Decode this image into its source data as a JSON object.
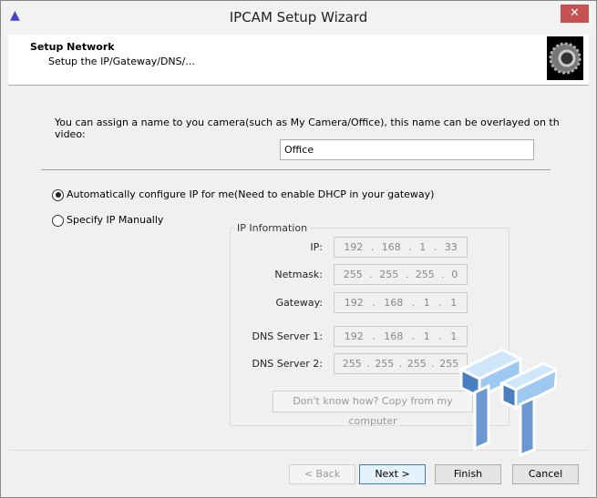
{
  "window": {
    "title": "IPCAM Setup Wizard",
    "close_label": "✕"
  },
  "header": {
    "title": "Setup Network",
    "subtitle": "Setup the IP/Gateway/DNS/..."
  },
  "name_section": {
    "prompt": "You can assign a name to you camera(such as My Camera/Office), this name can be overlayed on th video:",
    "value": "Office"
  },
  "options": {
    "auto": {
      "label": "Automatically configure IP for me(Need to enable DHCP in your gateway)",
      "selected": true
    },
    "manual": {
      "label": "Specify IP Manually",
      "selected": false
    }
  },
  "ip_info": {
    "legend": "IP Information",
    "fields": [
      {
        "label": "IP:",
        "octets": [
          "192",
          "168",
          "1",
          "33"
        ]
      },
      {
        "label": "Netmask:",
        "octets": [
          "255",
          "255",
          "255",
          "0"
        ]
      },
      {
        "label": "Gateway:",
        "octets": [
          "192",
          "168",
          "1",
          "1"
        ]
      },
      {
        "label": "DNS Server 1:",
        "octets": [
          "192",
          "168",
          "1",
          "1"
        ]
      },
      {
        "label": "DNS Server 2:",
        "octets": [
          "255",
          "255",
          "255",
          "255"
        ]
      }
    ],
    "copy_button": "Don't know how? Copy from my computer"
  },
  "buttons": {
    "back": "< Back",
    "next": "Next >",
    "finish": "Finish",
    "cancel": "Cancel"
  },
  "watermark": "TT"
}
